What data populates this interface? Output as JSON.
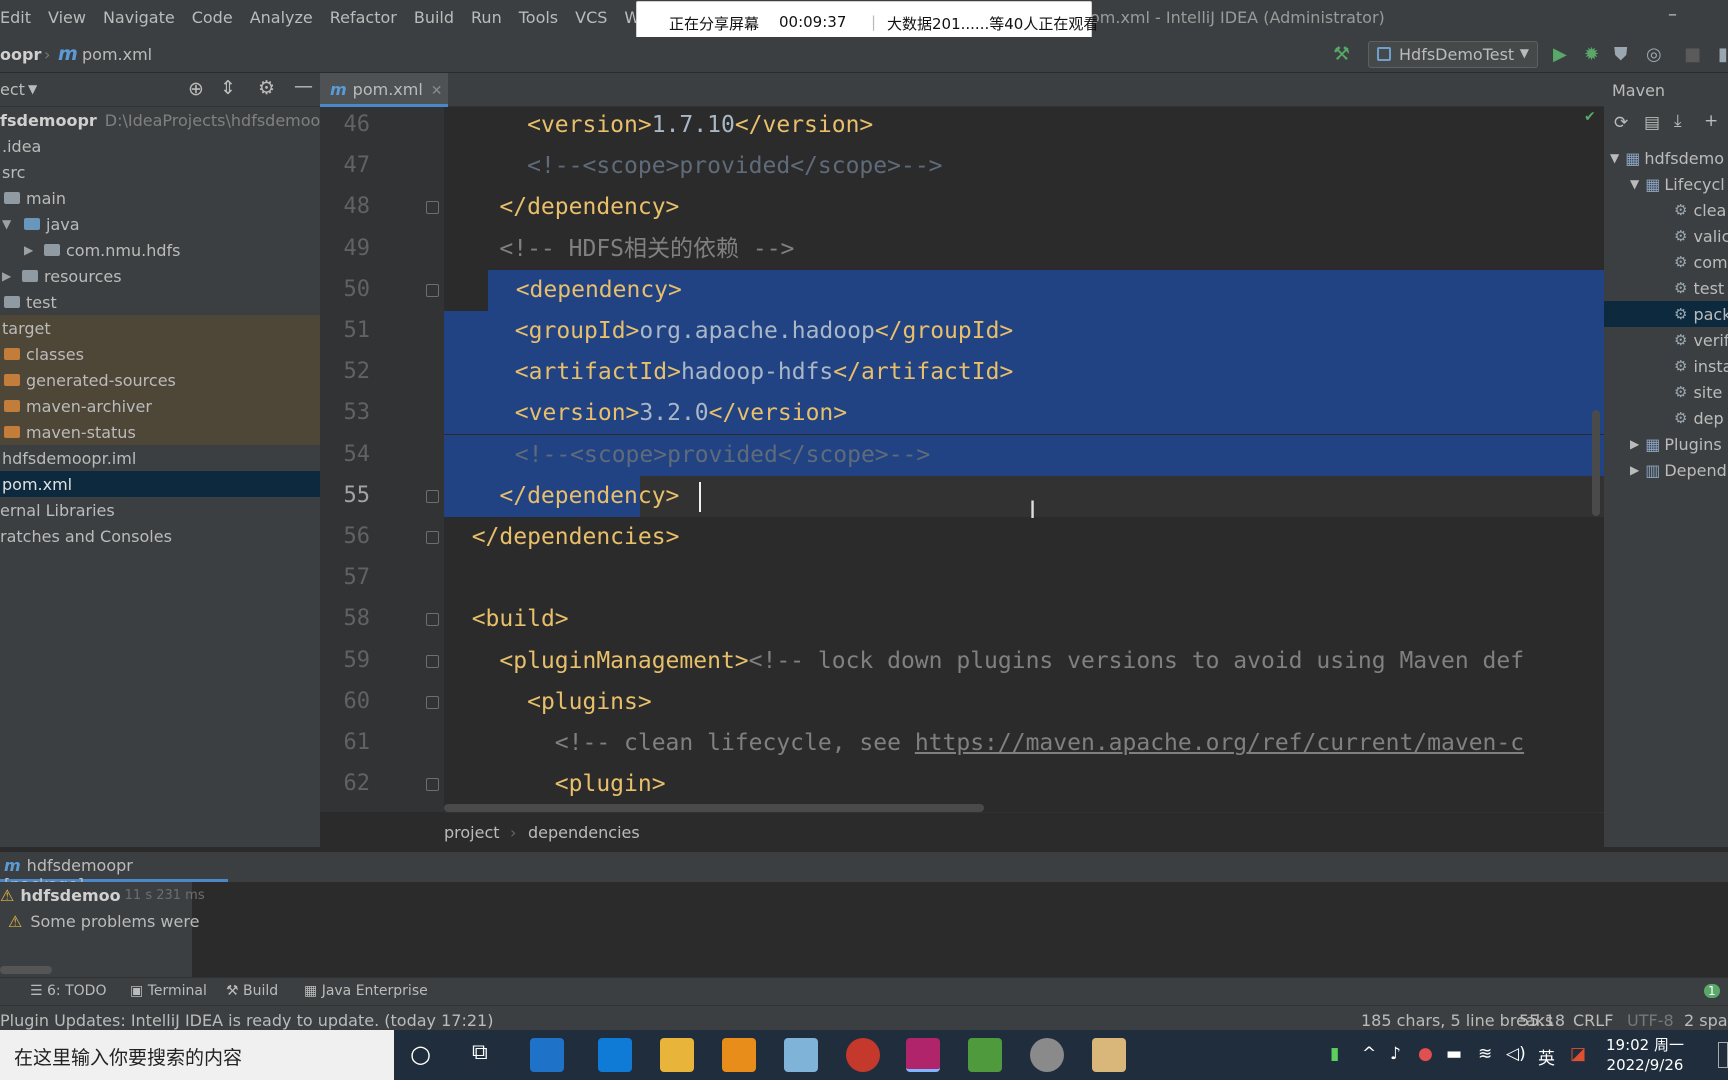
{
  "menubar": {
    "items": [
      "Edit",
      "View",
      "Navigate",
      "Code",
      "Analyze",
      "Refactor",
      "Build",
      "Run",
      "Tools",
      "VCS",
      "Window"
    ],
    "window_title": "om.xml - IntelliJ IDEA (Administrator)",
    "minimize": "–"
  },
  "share_overlay": {
    "status": "正在分享屏幕",
    "timer": "00:09:37",
    "viewers": "大数据201......等40人正在观看"
  },
  "navbar": {
    "project_crumb": "oopr",
    "file_crumb": "pom.xml",
    "run_config": "HdfsDemoTest"
  },
  "project_panel": {
    "header": "ect",
    "items": [
      {
        "label": "fsdemoopr",
        "path": "D:\\IdeaProjects\\hdfsdemoopr"
      },
      {
        "label": ".idea"
      },
      {
        "label": "src"
      },
      {
        "label": "main"
      },
      {
        "label": "java"
      },
      {
        "label": "com.nmu.hdfs"
      },
      {
        "label": "resources"
      },
      {
        "label": "test"
      },
      {
        "label": "target"
      },
      {
        "label": "classes"
      },
      {
        "label": "generated-sources"
      },
      {
        "label": "maven-archiver"
      },
      {
        "label": "maven-status"
      },
      {
        "label": "hdfsdemoopr.iml"
      },
      {
        "label": "pom.xml"
      },
      {
        "label": "ernal Libraries"
      },
      {
        "label": "ratches and Consoles"
      }
    ]
  },
  "editor": {
    "tab": "pom.xml",
    "line_numbers": [
      "46",
      "47",
      "48",
      "49",
      "50",
      "51",
      "52",
      "53",
      "54",
      "55",
      "56",
      "57",
      "58",
      "59",
      "60",
      "61",
      "62"
    ],
    "lines": [
      [
        "      ",
        "<version>",
        "1.7.10",
        "</version>",
        ""
      ],
      [
        "      ",
        "",
        "",
        "",
        "<!--<scope>provided</scope>-->"
      ],
      [
        "    ",
        "</dependency>",
        "",
        "",
        ""
      ],
      [
        "    ",
        "",
        "",
        "",
        "<!-- HDFS相关的依赖 -->"
      ],
      [
        "    ",
        "<dependency>",
        "",
        "",
        ""
      ],
      [
        "      ",
        "<groupId>",
        "org.apache.hadoop",
        "</groupId>",
        ""
      ],
      [
        "      ",
        "<artifactId>",
        "hadoop-hdfs",
        "</artifactId>",
        ""
      ],
      [
        "      ",
        "<version>",
        "3.2.0",
        "</version>",
        ""
      ],
      [
        "      ",
        "",
        "",
        "",
        "<!--<scope>provided</scope>-->"
      ],
      [
        "    ",
        "</dependency>",
        "",
        "",
        ""
      ],
      [
        "  ",
        "</dependencies>",
        "",
        "",
        ""
      ],
      [
        "",
        "",
        "",
        "",
        ""
      ],
      [
        "  ",
        "<build>",
        "",
        "",
        ""
      ],
      [
        "    ",
        "<pluginManagement>",
        "",
        "",
        "<!-- lock down plugins versions to avoid using Maven def"
      ],
      [
        "      ",
        "<plugins>",
        "",
        "",
        ""
      ],
      [
        "        ",
        "",
        "",
        "",
        "<!-- clean lifecycle, see "
      ],
      [
        "        ",
        "<plugin>",
        "",
        "",
        ""
      ]
    ],
    "url_text": "https://maven.apache.org/ref/current/maven-c",
    "breadcrumb": [
      "project",
      "dependencies"
    ]
  },
  "maven": {
    "header": "Maven",
    "items": [
      "hdfsdemo",
      "Lifecycl",
      "clea",
      "valic",
      "com",
      "test",
      "pack",
      "verif",
      "insta",
      "site",
      "dep",
      "Plugins",
      "Depend"
    ]
  },
  "run": {
    "tab": "hdfsdemoopr [package]",
    "tree_root": "hdfsdemoo",
    "tree_time": "11 s 231 ms",
    "warning": "Some problems were"
  },
  "toolstrip": {
    "todo": "6: TODO",
    "terminal": "Terminal",
    "build": "Build",
    "java_ee": "Java Enterprise",
    "event_count": "1"
  },
  "statusbar": {
    "message": "Plugin Updates: IntelliJ IDEA is ready to update. (today 17:21)",
    "selection": "185 chars, 5 line breaks",
    "position": "55:18",
    "line_sep": "CRLF",
    "encoding": "UTF-8",
    "indent": "2 spac"
  },
  "taskbar": {
    "search_placeholder": "在这里输入你要搜索的内容",
    "time": "19:02 周一",
    "date": "2022/9/26",
    "ime": "英"
  }
}
